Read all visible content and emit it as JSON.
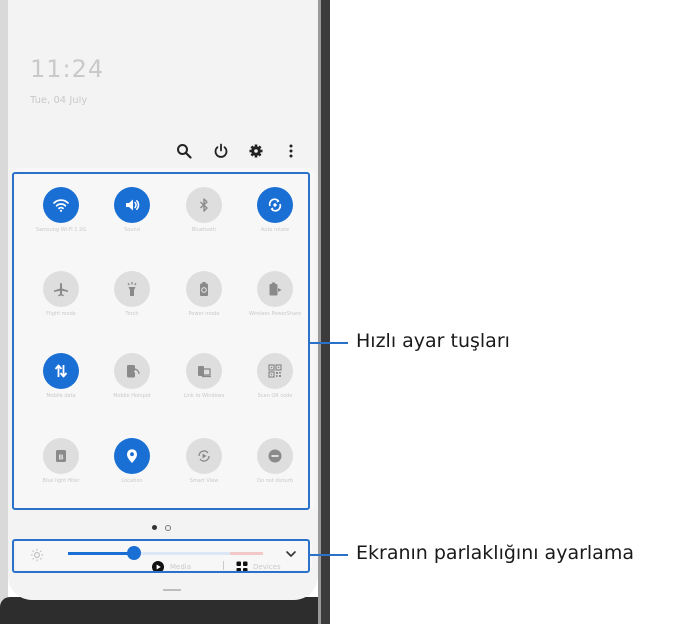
{
  "lockscreen": {
    "time": "11:24",
    "date": "Tue, 04 July"
  },
  "top_icons": [
    "search-icon",
    "power-icon",
    "settings-icon",
    "more-options-icon"
  ],
  "quick_settings": {
    "tiles": [
      {
        "label": "Samsung Wi-Fi 1 2G",
        "icon": "wifi-icon",
        "on": true
      },
      {
        "label": "Sound",
        "icon": "volume-icon",
        "on": true
      },
      {
        "label": "Bluetooth",
        "icon": "bluetooth-icon",
        "on": false
      },
      {
        "label": "Auto rotate",
        "icon": "rotate-icon",
        "on": true
      },
      {
        "label": "Flight mode",
        "icon": "airplane-icon",
        "on": false
      },
      {
        "label": "Torch",
        "icon": "torch-icon",
        "on": false
      },
      {
        "label": "Power mode",
        "icon": "battery-icon",
        "on": false
      },
      {
        "label": "Wireless PowerShare",
        "icon": "powershare-icon",
        "on": false
      },
      {
        "label": "Mobile data",
        "icon": "data-icon",
        "on": true
      },
      {
        "label": "Mobile Hotspot",
        "icon": "hotspot-icon",
        "on": false
      },
      {
        "label": "Link to Windows",
        "icon": "link-windows-icon",
        "on": false
      },
      {
        "label": "Scan QR code",
        "icon": "qr-icon",
        "on": false
      },
      {
        "label": "Blue light filter",
        "icon": "bluelight-icon",
        "on": false
      },
      {
        "label": "Location",
        "icon": "location-icon",
        "on": true
      },
      {
        "label": "Smart View",
        "icon": "smartview-icon",
        "on": false
      },
      {
        "label": "Do not disturb",
        "icon": "dnd-icon",
        "on": false
      }
    ]
  },
  "page_indicator": {
    "pages": 2,
    "current": 1
  },
  "brightness": {
    "level_fraction": 0.32
  },
  "media_row": {
    "media_label": "Media",
    "devices_label": "Devices"
  },
  "callouts": {
    "quick_settings": "Hızlı ayar tuşları",
    "brightness": "Ekranın parlaklığını ayarlama"
  },
  "colors": {
    "accent": "#1a6fd4",
    "callout": "#2a72c9",
    "tile_off": "#dedede"
  }
}
